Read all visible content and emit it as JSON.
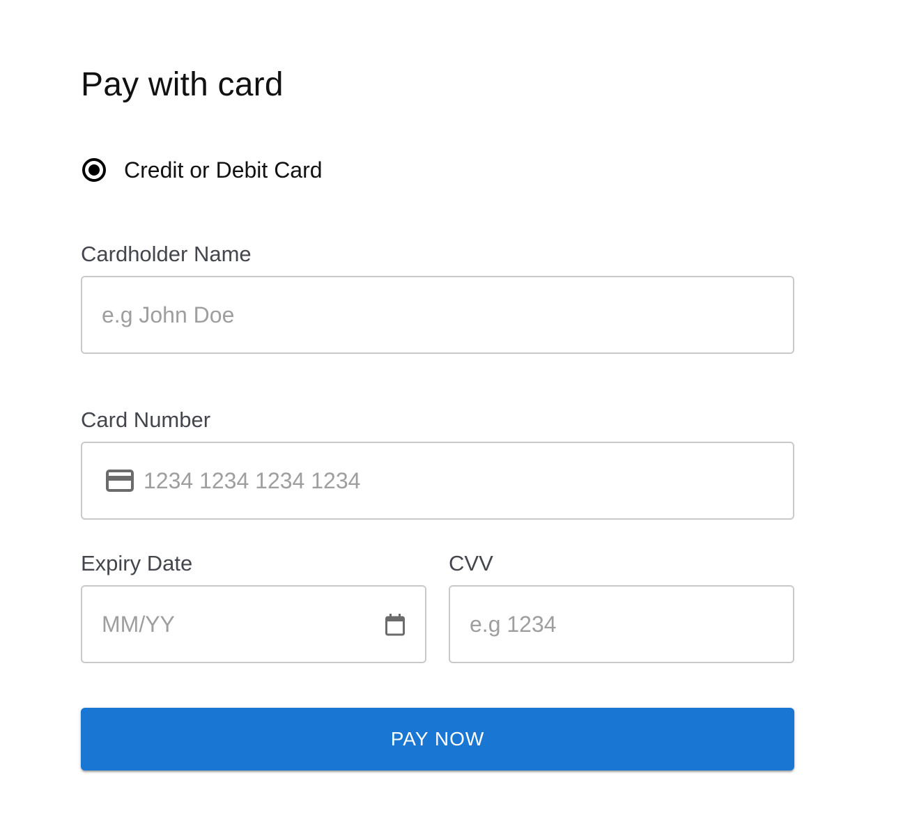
{
  "page": {
    "title": "Pay with card"
  },
  "payment_method": {
    "label": "Credit or Debit Card",
    "selected": true
  },
  "form": {
    "cardholder_name": {
      "label": "Cardholder Name",
      "placeholder": "e.g John Doe",
      "value": ""
    },
    "card_number": {
      "label": "Card Number",
      "placeholder": "1234 1234 1234 1234",
      "value": "",
      "icon": "credit-card-icon"
    },
    "expiry_date": {
      "label": "Expiry Date",
      "placeholder": "MM/YY",
      "value": "",
      "icon": "calendar-icon"
    },
    "cvv": {
      "label": "CVV",
      "placeholder": "e.g 1234",
      "value": ""
    }
  },
  "actions": {
    "pay_label": "PAY NOW"
  },
  "colors": {
    "accent": "#1976d2",
    "label_text": "#44464d",
    "placeholder_text": "#9e9e9e",
    "field_border": "#c9c9cc"
  }
}
